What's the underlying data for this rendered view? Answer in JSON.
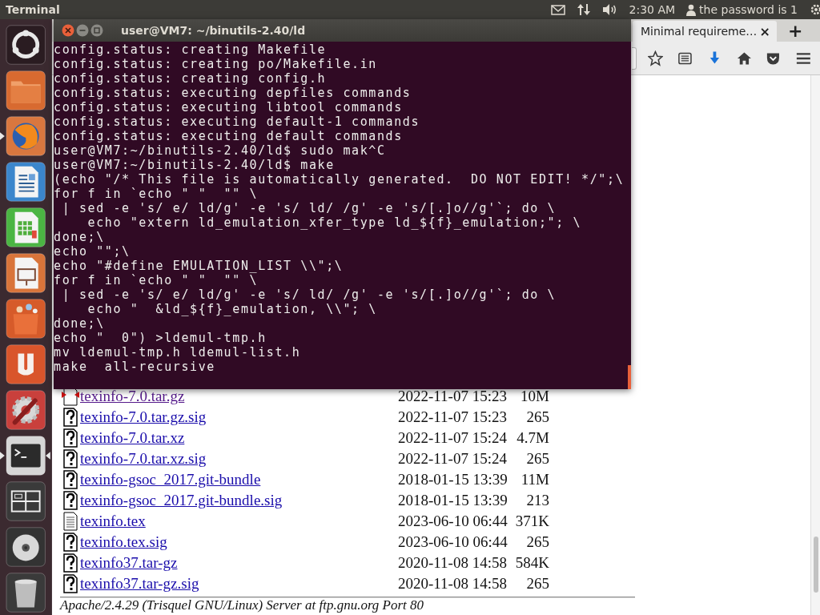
{
  "top_panel": {
    "app_title": "Terminal",
    "clock": "2:30 AM",
    "user": "the password is 1"
  },
  "launcher": {
    "items": [
      {
        "kind": "dash",
        "running": false,
        "focused": false
      },
      {
        "kind": "files",
        "running": false,
        "focused": false
      },
      {
        "kind": "browser",
        "running": true,
        "focused": false
      },
      {
        "kind": "writer",
        "running": false,
        "focused": false
      },
      {
        "kind": "calc",
        "running": false,
        "focused": false
      },
      {
        "kind": "impress",
        "running": false,
        "focused": false
      },
      {
        "kind": "store",
        "running": false,
        "focused": false
      },
      {
        "kind": "u",
        "running": false,
        "focused": false
      },
      {
        "kind": "settings",
        "running": false,
        "focused": false
      },
      {
        "kind": "terminal",
        "running": true,
        "focused": true
      },
      {
        "kind": "workspaces",
        "running": false,
        "focused": false
      },
      {
        "kind": "disc",
        "running": false,
        "focused": false
      },
      {
        "kind": "trash",
        "running": false,
        "focused": false
      }
    ]
  },
  "browser": {
    "tabs": [
      {
        "label": "Minimal requireme…",
        "selected": true,
        "close": "×"
      }
    ],
    "new_tab": "+",
    "listing": {
      "rows": [
        {
          "kind": "archive",
          "name": "texinfo-7.0.tar.gz",
          "date": "2022-11-07 15:23",
          "size": "10M",
          "visited": true
        },
        {
          "kind": "unknown",
          "name": "texinfo-7.0.tar.gz.sig",
          "date": "2022-11-07 15:23",
          "size": "265",
          "visited": false
        },
        {
          "kind": "unknown",
          "name": "texinfo-7.0.tar.xz",
          "date": "2022-11-07 15:24",
          "size": "4.7M",
          "visited": false
        },
        {
          "kind": "unknown",
          "name": "texinfo-7.0.tar.xz.sig",
          "date": "2022-11-07 15:24",
          "size": "265",
          "visited": false
        },
        {
          "kind": "unknown",
          "name": "texinfo-gsoc_2017.git-bundle",
          "date": "2018-01-15 13:39",
          "size": "11M",
          "visited": false
        },
        {
          "kind": "unknown",
          "name": "texinfo-gsoc_2017.git-bundle.sig",
          "date": "2018-01-15 13:39",
          "size": "213",
          "visited": false
        },
        {
          "kind": "text",
          "name": "texinfo.tex",
          "date": "2023-06-10 06:44",
          "size": "371K",
          "visited": false
        },
        {
          "kind": "unknown",
          "name": "texinfo.tex.sig",
          "date": "2023-06-10 06:44",
          "size": "265",
          "visited": false
        },
        {
          "kind": "unknown",
          "name": "texinfo37.tar-gz",
          "date": "2020-11-08 14:58",
          "size": "584K",
          "visited": false
        },
        {
          "kind": "unknown",
          "name": "texinfo37.tar-gz.sig",
          "date": "2020-11-08 14:58",
          "size": "265",
          "visited": false
        }
      ]
    },
    "footer": "Apache/2.4.29 (Trisquel GNU/Linux) Server at ftp.gnu.org Port 80"
  },
  "terminal": {
    "title": "user@VM7: ~/binutils-2.40/ld",
    "lines": [
      "config.status: creating Makefile",
      "config.status: creating po/Makefile.in",
      "config.status: creating config.h",
      "config.status: executing depfiles commands",
      "config.status: executing libtool commands",
      "config.status: executing default-1 commands",
      "config.status: executing default commands",
      "user@VM7:~/binutils-2.40/ld$ sudo mak^C",
      "user@VM7:~/binutils-2.40/ld$ make",
      "(echo \"/* This file is automatically generated.  DO NOT EDIT! */\";\\",
      "for f in `echo \" \"  \"\" \\",
      " | sed -e 's/ e/ ld/g' -e 's/ ld/ /g' -e 's/[.]o//g'`; do \\",
      "    echo \"extern ld_emulation_xfer_type ld_${f}_emulation;\"; \\",
      "done;\\",
      "echo \"\";\\",
      "echo \"#define EMULATION_LIST \\\\\";\\",
      "for f in `echo \" \"  \"\" \\",
      " | sed -e 's/ e/ ld/g' -e 's/ ld/ /g' -e 's/[.]o//g'`; do \\",
      "    echo \"  &ld_${f}_emulation, \\\\\"; \\",
      "done;\\",
      "echo \"  0\") >ldemul-tmp.h",
      "mv ldemul-tmp.h ldemul-list.h",
      "make  all-recursive"
    ]
  }
}
